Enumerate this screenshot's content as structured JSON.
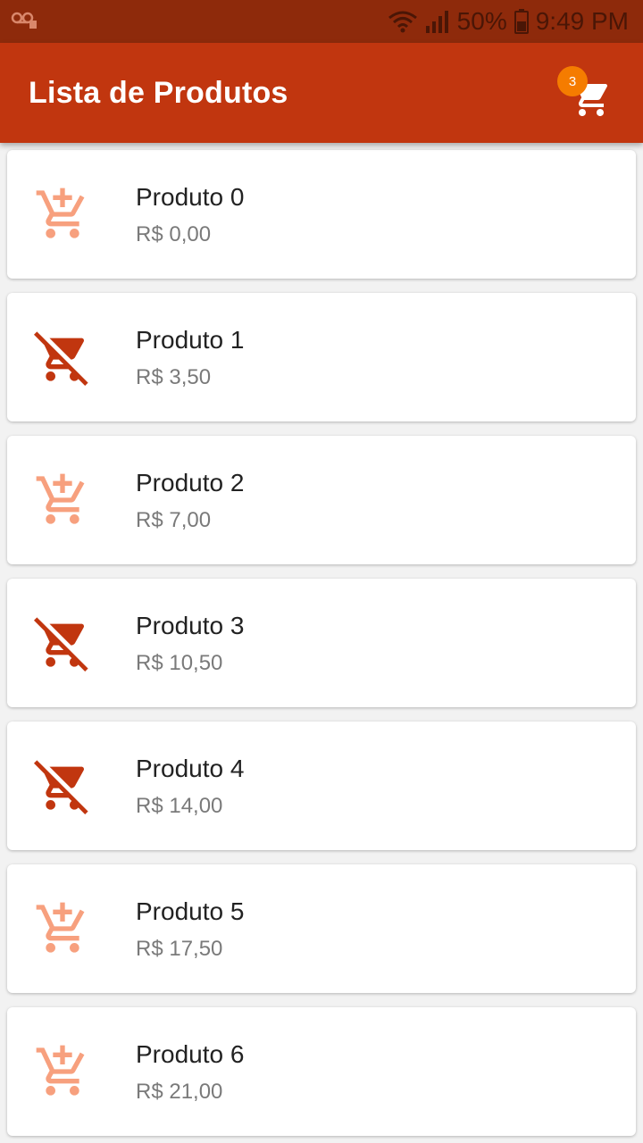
{
  "status_bar": {
    "battery": "50%",
    "time": "9:49 PM",
    "icons": [
      "voicemail-icon",
      "wifi-icon",
      "signal-icon",
      "battery-icon"
    ]
  },
  "app_bar": {
    "title": "Lista de Produtos",
    "cart_icon": "shopping-cart-icon",
    "cart_count": "3"
  },
  "colors": {
    "primary": "#c1360f",
    "status_bar": "#8e2a0b",
    "badge": "#f57c00",
    "add_icon": "#f7a07e",
    "remove_icon": "#c1360f"
  },
  "products": [
    {
      "name": "Produto 0",
      "price": "R$ 0,00",
      "in_cart": false,
      "icon": "add-shopping-cart-icon"
    },
    {
      "name": "Produto 1",
      "price": "R$ 3,50",
      "in_cart": true,
      "icon": "remove-shopping-cart-icon"
    },
    {
      "name": "Produto 2",
      "price": "R$ 7,00",
      "in_cart": false,
      "icon": "add-shopping-cart-icon"
    },
    {
      "name": "Produto 3",
      "price": "R$ 10,50",
      "in_cart": true,
      "icon": "remove-shopping-cart-icon"
    },
    {
      "name": "Produto 4",
      "price": "R$ 14,00",
      "in_cart": true,
      "icon": "remove-shopping-cart-icon"
    },
    {
      "name": "Produto 5",
      "price": "R$ 17,50",
      "in_cart": false,
      "icon": "add-shopping-cart-icon"
    },
    {
      "name": "Produto 6",
      "price": "R$ 21,00",
      "in_cart": false,
      "icon": "add-shopping-cart-icon"
    }
  ]
}
